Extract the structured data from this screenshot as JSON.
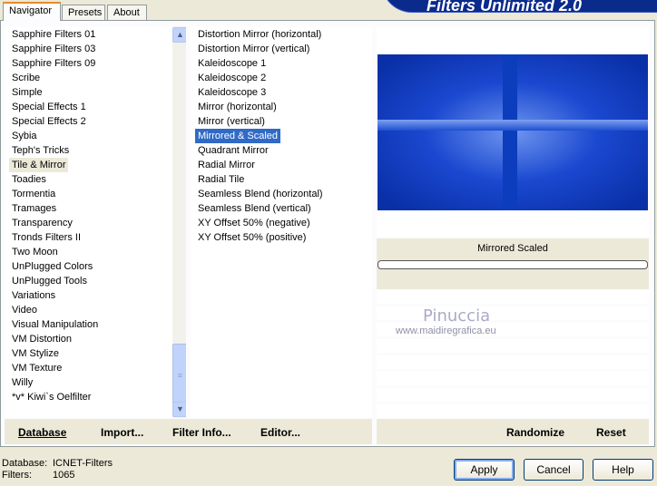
{
  "tabs": [
    "Navigator",
    "Presets",
    "About"
  ],
  "banner": "Filters Unlimited 2.0",
  "categories": [
    "Sapphire Filters 01",
    "Sapphire Filters 03",
    "Sapphire Filters 09",
    "Scribe",
    "Simple",
    "Special Effects 1",
    "Special Effects 2",
    "Sybia",
    "Teph's Tricks",
    "Tile & Mirror",
    "Toadies",
    "Tormentia",
    "Tramages",
    "Transparency",
    "Tronds Filters II",
    "Two Moon",
    "UnPlugged Colors",
    "UnPlugged Tools",
    "Variations",
    "Video",
    "Visual Manipulation",
    "VM Distortion",
    "VM Stylize",
    "VM Texture",
    "Willy",
    "*v* Kiwi`s Oelfilter"
  ],
  "selected_category": "Tile & Mirror",
  "filters": [
    "Distortion Mirror (horizontal)",
    "Distortion Mirror (vertical)",
    "Kaleidoscope 1",
    "Kaleidoscope 2",
    "Kaleidoscope 3",
    "Mirror (horizontal)",
    "Mirror (vertical)",
    "Mirrored & Scaled",
    "Quadrant Mirror",
    "Radial Mirror",
    "Radial Tile",
    "Seamless Blend (horizontal)",
    "Seamless Blend (vertical)",
    "XY Offset 50% (negative)",
    "XY Offset 50% (positive)"
  ],
  "selected_filter": "Mirrored & Scaled",
  "preview_label": "Mirrored  Scaled",
  "progress": 0,
  "watermark": {
    "name": "Pinuccia",
    "url": "www.maidiregrafica.eu"
  },
  "toolbar": {
    "database": "Database",
    "import": "Import...",
    "filter_info": "Filter Info...",
    "editor": "Editor...",
    "randomize": "Randomize",
    "reset": "Reset"
  },
  "status": {
    "database_label": "Database:",
    "database_value": "ICNET-Filters",
    "filters_label": "Filters:",
    "filters_value": "1065"
  },
  "buttons": {
    "apply": "Apply",
    "cancel": "Cancel",
    "help": "Help"
  },
  "colors": {
    "selection": "#316ac5",
    "banner": "#0a2a8c",
    "preview": "#0a3cc8"
  }
}
